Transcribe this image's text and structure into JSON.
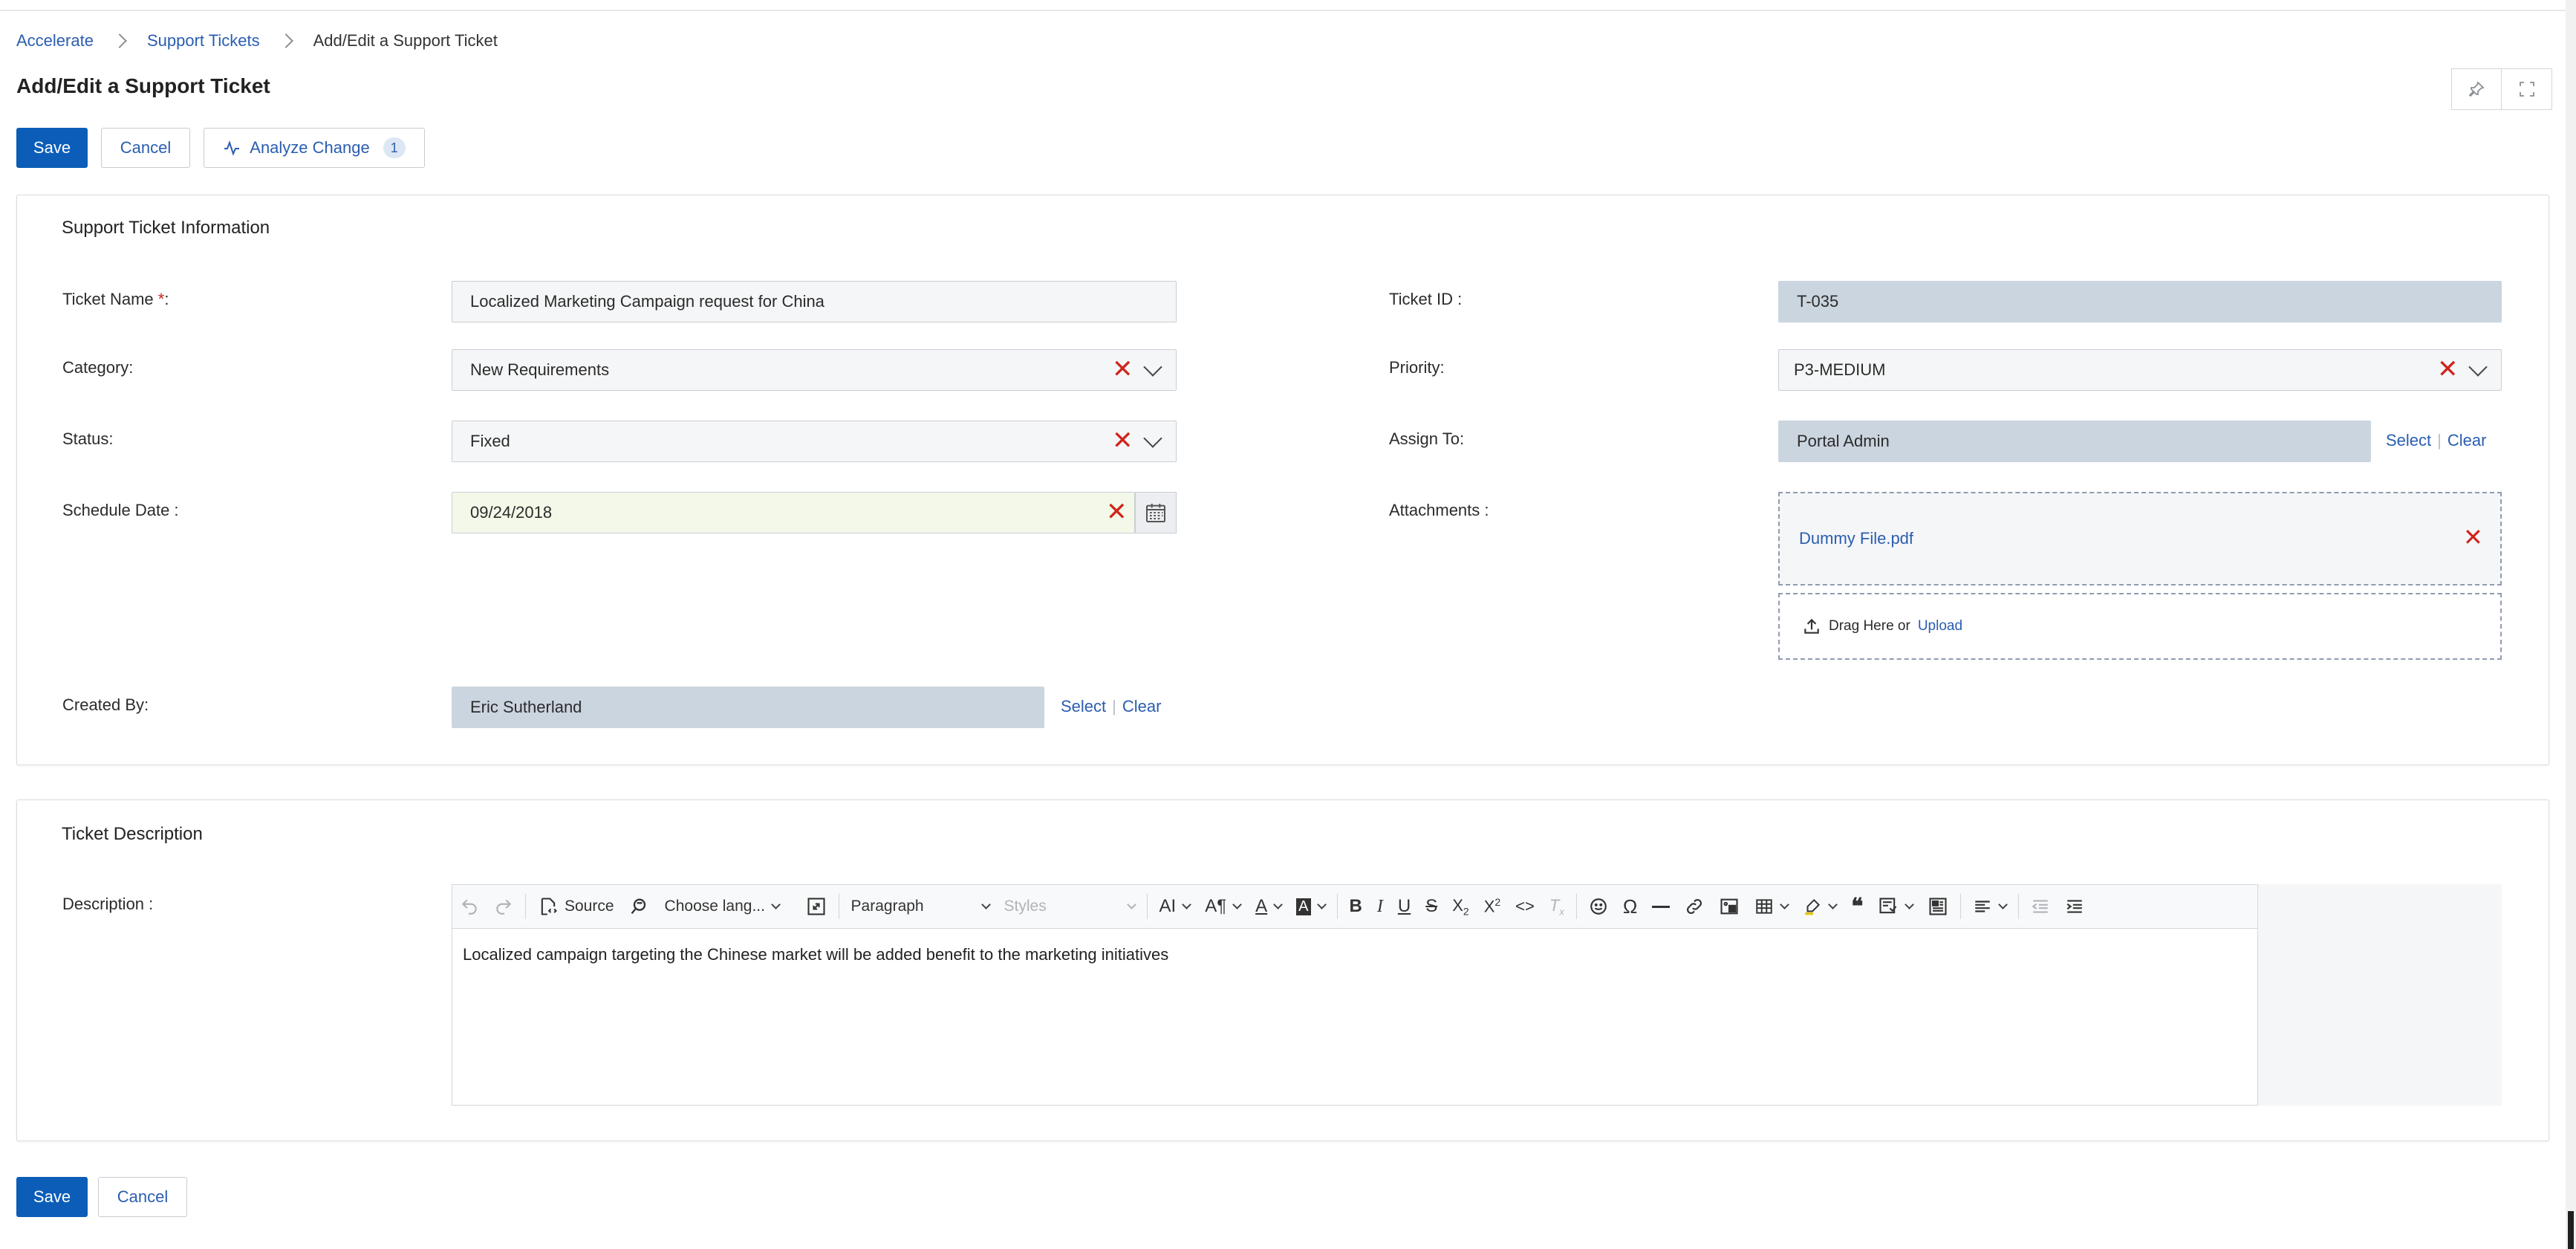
{
  "breadcrumb": {
    "items": [
      "Accelerate",
      "Support Tickets"
    ],
    "current": "Add/Edit a Support Ticket"
  },
  "page": {
    "title": "Add/Edit a Support Ticket"
  },
  "actions": {
    "save_label": "Save",
    "cancel_label": "Cancel",
    "analyze_label": "Analyze Change",
    "analyze_count": "1"
  },
  "ticket_info": {
    "section_title": "Support Ticket Information",
    "ticket_name": {
      "label": "Ticket Name",
      "required_mark": "*",
      "label_suffix": ":",
      "value": "Localized Marketing Campaign request for China"
    },
    "ticket_id": {
      "label": "Ticket ID :",
      "value": "T-035"
    },
    "category": {
      "label": "Category:",
      "value": "New Requirements"
    },
    "priority": {
      "label": "Priority:",
      "value": "P3-MEDIUM"
    },
    "status": {
      "label": "Status:",
      "value": "Fixed"
    },
    "assign_to": {
      "label": "Assign To:",
      "value": "Portal Admin",
      "select_label": "Select",
      "clear_label": "Clear"
    },
    "schedule_date": {
      "label": "Schedule Date :",
      "value": "09/24/2018"
    },
    "attachments": {
      "label": "Attachments :",
      "file_name": "Dummy File.pdf",
      "drag_text": "Drag Here or",
      "upload_label": "Upload"
    },
    "created_by": {
      "label": "Created By:",
      "value": "Eric Sutherland",
      "select_label": "Select",
      "clear_label": "Clear"
    }
  },
  "ticket_description": {
    "section_title": "Ticket Description",
    "label": "Description :",
    "toolbar": {
      "source_label": "Source",
      "language_label": "Choose lang...",
      "paragraph_label": "Paragraph",
      "styles_label": "Styles"
    },
    "content": "Localized campaign targeting the Chinese market will be added benefit to the marketing initiatives"
  },
  "colors": {
    "primary": "#0b5db8",
    "link": "#2a5db0",
    "danger": "#d0241b",
    "readonly_bg": "#cbd5df",
    "date_bg": "#f3f8e8"
  }
}
